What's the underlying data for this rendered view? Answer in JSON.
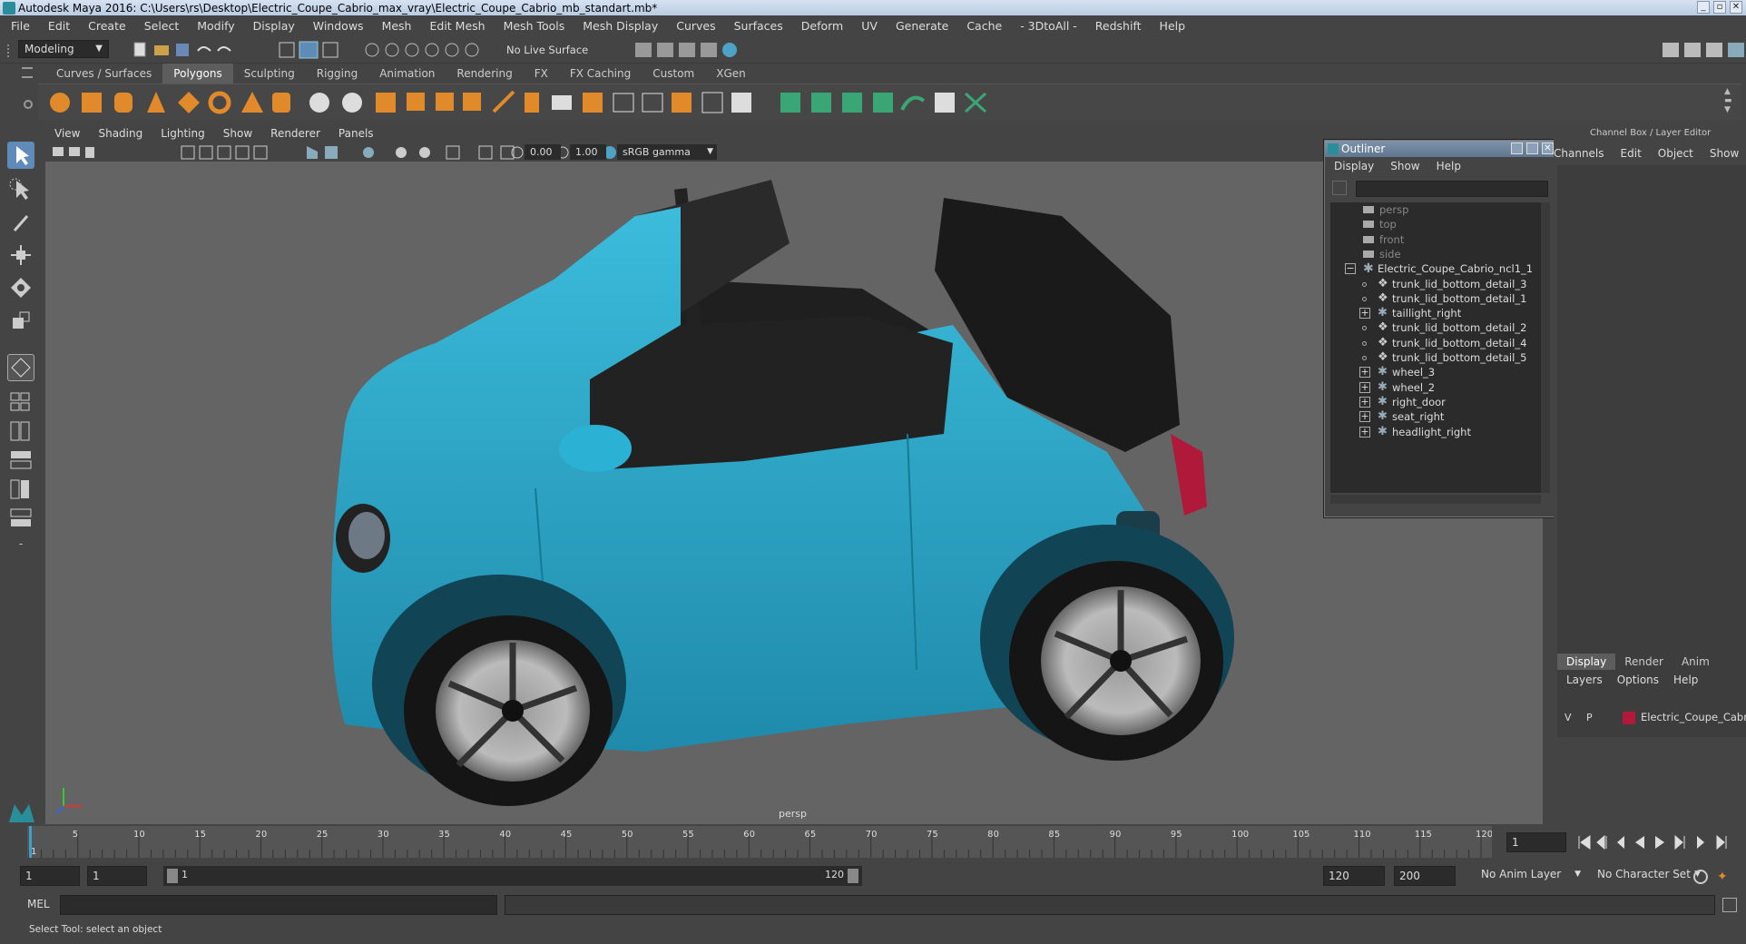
{
  "window": {
    "title": "Autodesk Maya 2016: C:\\Users\\rs\\Desktop\\Electric_Coupe_Cabrio_max_vray\\Electric_Coupe_Cabrio_mb_standart.mb*"
  },
  "menubar": [
    "File",
    "Edit",
    "Create",
    "Select",
    "Modify",
    "Display",
    "Windows",
    "Mesh",
    "Edit Mesh",
    "Mesh Tools",
    "Mesh Display",
    "Curves",
    "Surfaces",
    "Deform",
    "UV",
    "Generate",
    "Cache",
    "- 3DtoAll -",
    "Redshift",
    "Help"
  ],
  "status": {
    "mode": "Modeling",
    "live_surface": "No Live Surface"
  },
  "shelf_tabs": [
    "Curves / Surfaces",
    "Polygons",
    "Sculpting",
    "Rigging",
    "Animation",
    "Rendering",
    "FX",
    "FX Caching",
    "Custom",
    "XGen"
  ],
  "shelf_active": "Polygons",
  "viewport": {
    "menu": [
      "View",
      "Shading",
      "Lighting",
      "Show",
      "Renderer",
      "Panels"
    ],
    "exposure": "0.00",
    "gamma": "1.00",
    "color_space": "sRGB gamma",
    "camera_label": "persp"
  },
  "outliner": {
    "title": "Outliner",
    "menu": [
      "Display",
      "Show",
      "Help"
    ],
    "items": [
      {
        "label": "persp",
        "type": "camera"
      },
      {
        "label": "top",
        "type": "camera"
      },
      {
        "label": "front",
        "type": "camera"
      },
      {
        "label": "side",
        "type": "camera"
      },
      {
        "label": "Electric_Coupe_Cabrio_ncl1_1",
        "type": "group"
      },
      {
        "label": "trunk_lid_bottom_detail_3",
        "type": "mesh"
      },
      {
        "label": "trunk_lid_bottom_detail_1",
        "type": "mesh"
      },
      {
        "label": "taillight_right",
        "type": "group"
      },
      {
        "label": "trunk_lid_bottom_detail_2",
        "type": "mesh"
      },
      {
        "label": "trunk_lid_bottom_detail_4",
        "type": "mesh"
      },
      {
        "label": "trunk_lid_bottom_detail_5",
        "type": "mesh"
      },
      {
        "label": "wheel_3",
        "type": "group"
      },
      {
        "label": "wheel_2",
        "type": "group"
      },
      {
        "label": "right_door",
        "type": "group"
      },
      {
        "label": "seat_right",
        "type": "group"
      },
      {
        "label": "headlight_right",
        "type": "group"
      }
    ]
  },
  "channel_box": {
    "title": "Channel Box / Layer Editor",
    "menu": [
      "Channels",
      "Edit",
      "Object",
      "Show"
    ],
    "layer_tabs": [
      "Display",
      "Render",
      "Anim"
    ],
    "layer_menu": [
      "Layers",
      "Options",
      "Help"
    ],
    "layer": {
      "v": "V",
      "p": "P",
      "name": "Electric_Coupe_Cabrio",
      "color": "#b0193a"
    }
  },
  "timeline": {
    "ticks": [
      "1",
      "5",
      "10",
      "15",
      "20",
      "25",
      "30",
      "35",
      "40",
      "45",
      "50",
      "55",
      "60",
      "65",
      "70",
      "75",
      "80",
      "85",
      "90",
      "95",
      "100",
      "105",
      "110",
      "115",
      "120"
    ],
    "current_frame": "1"
  },
  "range": {
    "start": "1",
    "inner_start": "1",
    "slider_start": "1",
    "slider_end": "120",
    "end": "120",
    "outer_end": "200",
    "anim_layer": "No Anim Layer",
    "char_set": "No Character Set"
  },
  "command_line": {
    "label": "MEL"
  },
  "help_line": "Select Tool: select an object",
  "colors": {
    "car_body": "#29a3c2",
    "viewport_bg": "#646464",
    "accent": "#5d5d5d"
  }
}
